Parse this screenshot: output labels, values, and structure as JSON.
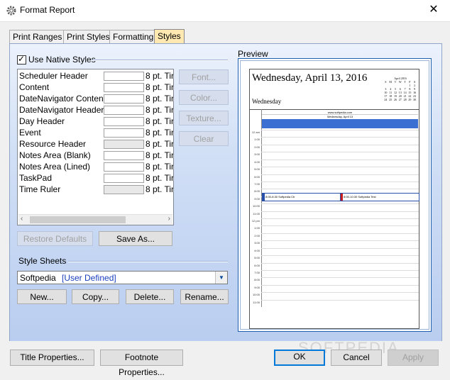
{
  "window": {
    "title": "Format Report",
    "close_glyph": "✕"
  },
  "tabs": [
    {
      "label": "Print Ranges"
    },
    {
      "label": "Print Styles"
    },
    {
      "label": "Formatting"
    },
    {
      "label": "Styles",
      "active": true
    }
  ],
  "native_styles": {
    "label": "Use Native Styles",
    "checked": true
  },
  "style_list": [
    {
      "name": "Scheduler Header",
      "font": "8 pt. Tir"
    },
    {
      "name": "Content",
      "font": "8 pt. Tir"
    },
    {
      "name": "DateNavigator Content",
      "font": "8 pt. Tir"
    },
    {
      "name": "DateNavigator Header",
      "font": "8 pt. Tir"
    },
    {
      "name": "Day Header",
      "font": "8 pt. Tir"
    },
    {
      "name": "Event",
      "font": "8 pt. Tir"
    },
    {
      "name": "Resource Header",
      "font": "8 pt. Tir"
    },
    {
      "name": "Notes Area (Blank)",
      "font": "8 pt. Tir"
    },
    {
      "name": "Notes Area (Lined)",
      "font": "8 pt. Tir"
    },
    {
      "name": "TaskPad",
      "font": "8 pt. Tir"
    },
    {
      "name": "Time Ruler",
      "font": "8 pt. Tir"
    }
  ],
  "side_buttons": {
    "font": "Font...",
    "color": "Color...",
    "texture": "Texture...",
    "clear": "Clear"
  },
  "list_buttons": {
    "restore": "Restore Defaults",
    "save_as": "Save As..."
  },
  "style_sheets": {
    "heading": "Style Sheets",
    "selected_name": "Softpedia",
    "selected_tag": "[User Defined]",
    "new": "New...",
    "copy": "Copy...",
    "delete": "Delete...",
    "rename": "Rename..."
  },
  "preview": {
    "heading": "Preview",
    "date_title": "Wednesday, April 13, 2016",
    "day_name": "Wednesday",
    "mini_month": "April 2016",
    "mini_weekdays": [
      "S",
      "M",
      "T",
      "W",
      "T",
      "F",
      "S"
    ],
    "mini_days": [
      [
        "",
        "",
        "",
        "",
        "",
        "1",
        "2"
      ],
      [
        "3",
        "4",
        "5",
        "6",
        "7",
        "8",
        "9"
      ],
      [
        "10",
        "11",
        "12",
        "13",
        "14",
        "15",
        "16"
      ],
      [
        "17",
        "18",
        "19",
        "20",
        "21",
        "22",
        "23"
      ],
      [
        "24",
        "25",
        "26",
        "27",
        "28",
        "29",
        "30"
      ]
    ],
    "resource": "www.softpedia.com",
    "day_header": "Wednesday, April 13",
    "times": [
      "12 am",
      "1:00",
      "2:00",
      "3:00",
      "4:00",
      "5:00",
      "6:00",
      "7:00",
      "8:00",
      "9:00",
      "10:00",
      "11:00",
      "12 pm",
      "1:00",
      "2:00",
      "3:00",
      "4:00",
      "5:00",
      "6:00",
      "7:00",
      "8:00",
      "9:00",
      "10:00",
      "11:00"
    ],
    "events": [
      "8:00-8:30 Softpedia Ctr",
      "8:00-10:30 Softpedia Test"
    ]
  },
  "footer": {
    "title_props": "Title Properties...",
    "footnote_props": "Footnote Properties...",
    "ok": "OK",
    "cancel": "Cancel",
    "apply": "Apply",
    "watermark": "SOFTPEDIA"
  },
  "colors": {
    "accent": "#0078d7",
    "event_bar": "#3b6fd1",
    "active_tab": "#ffe9b0"
  }
}
